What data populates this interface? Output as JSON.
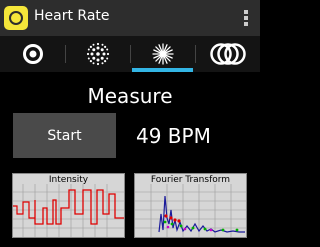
{
  "app": {
    "title": "Heart Rate",
    "brand_color": "#f5e63a",
    "accent_color": "#33b5e5"
  },
  "tabs": [
    {
      "icon": "ring-icon",
      "selected": false
    },
    {
      "icon": "dot-grid-icon",
      "selected": false
    },
    {
      "icon": "starburst-icon",
      "selected": true
    },
    {
      "icon": "triple-ring-icon",
      "selected": false
    }
  ],
  "main": {
    "heading": "Measure",
    "start_label": "Start",
    "bpm_text": "49 BPM"
  },
  "graphs": {
    "intensity_title": "Intensity",
    "fourier_title": "Fourier Transform"
  }
}
